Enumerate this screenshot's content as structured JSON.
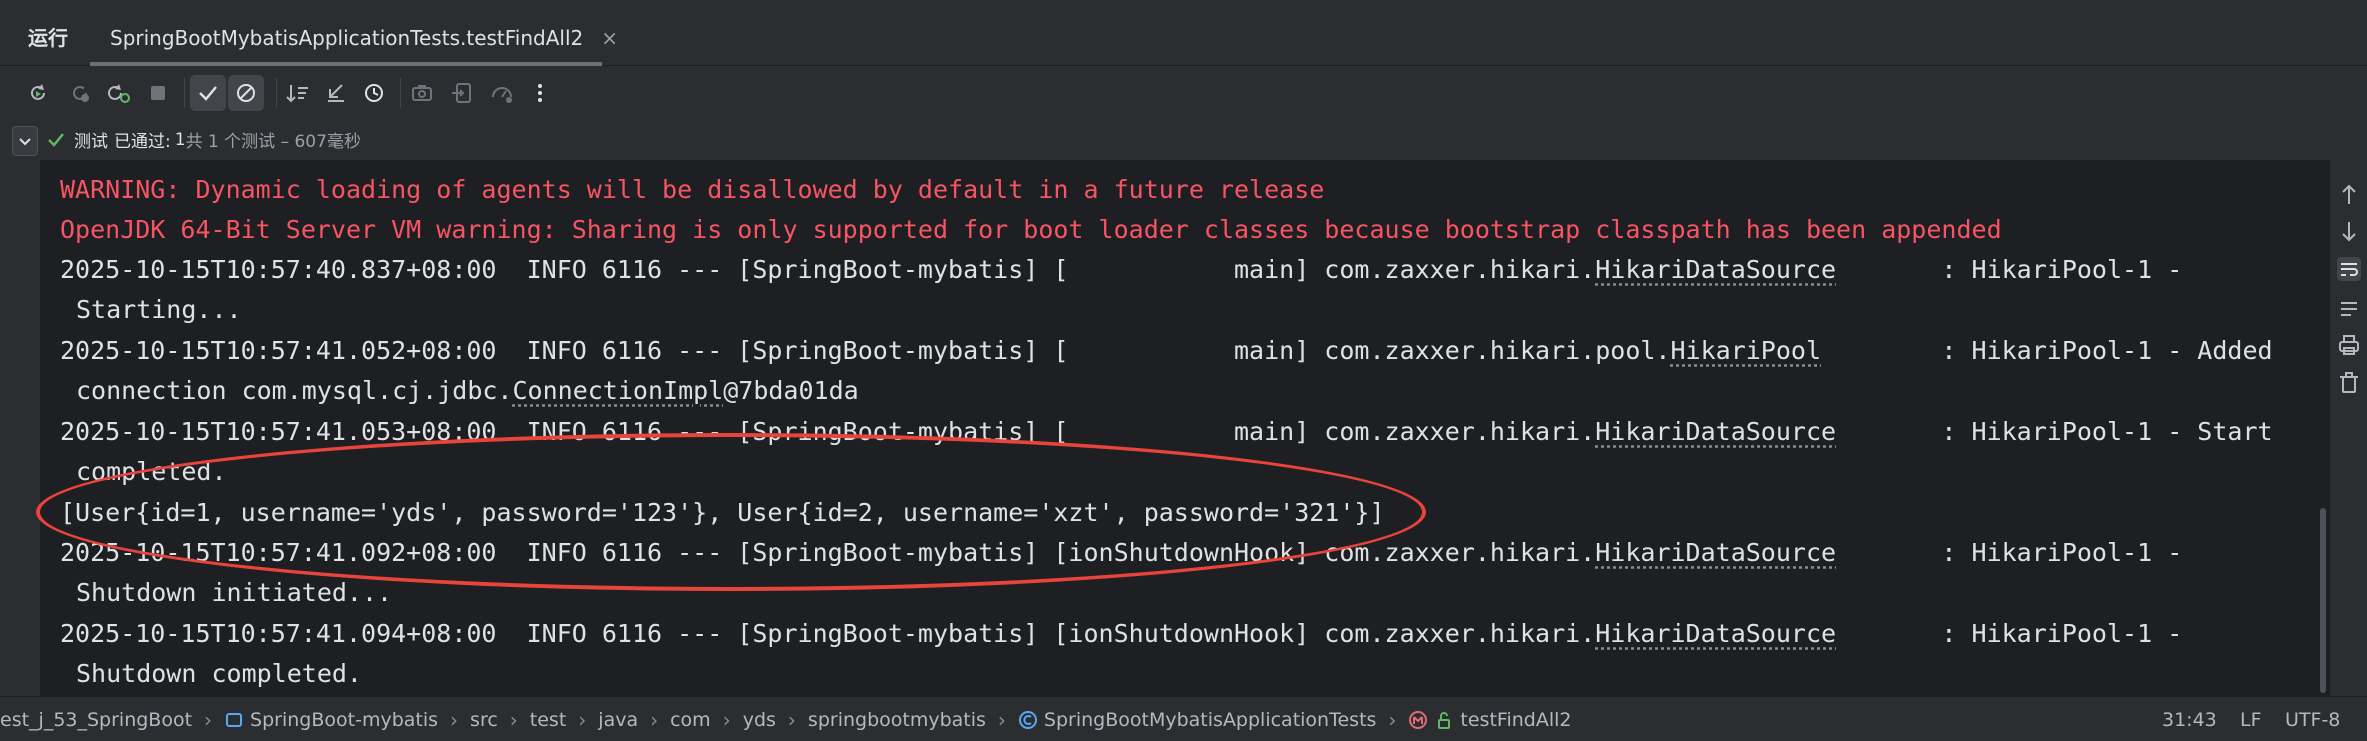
{
  "header": {
    "run_label": "运行",
    "tab_title": "SpringBootMybatisApplicationTests.testFindAll2",
    "tab_close": "×"
  },
  "status": {
    "test_label": "测试",
    "passed_label": "已通过:",
    "passed_count": "1",
    "detail": "共 1 个测试 – 607毫秒"
  },
  "console": {
    "lines": [
      "WARNING: Dynamic loading of agents will be disallowed by default in a future release",
      "OpenJDK 64-Bit Server VM warning: Sharing is only supported for boot loader classes because bootstrap classpath has been appended",
      "2025-10-15T10:57:40.837+08:00  INFO 6116 --- [SpringBoot-mybatis] [           main] com.zaxxer.hikari.",
      "Starting...",
      "2025-10-15T10:57:41.052+08:00  INFO 6116 --- [SpringBoot-mybatis] [           main] com.zaxxer.hikari.pool.",
      "connection com.mysql.cj.jdbc.",
      "2025-10-15T10:57:41.053+08:00  INFO 6116 --- [SpringBoot-mybatis] [           main] com.zaxxer.hikari.",
      "completed.",
      "[User{id=1, username='yds', password='123'}, User{id=2, username='xzt', password='321'}]",
      "2025-10-15T10:57:41.092+08:00  INFO 6116 --- [SpringBoot-mybatis] [ionShutdownHook] com.zaxxer.hikari.",
      "Shutdown initiated...",
      "2025-10-15T10:57:41.094+08:00  INFO 6116 --- [SpringBoot-mybatis] [ionShutdownHook] com.zaxxer.hikari.",
      "Shutdown completed."
    ],
    "links": {
      "ds1": "HikariDataSource",
      "pool": "HikariPool",
      "conn": "ConnectionImpl",
      "conn_suffix": "@7bda01da",
      "ds2": "HikariDataSource",
      "ds3": "HikariDataSource",
      "ds4": "HikariDataSource"
    },
    "tails": {
      "l1": "       : HikariPool-1 -",
      "l2": "        : HikariPool-1 - Added",
      "l3": "       : HikariPool-1 - Start",
      "l4": "       : HikariPool-1 -",
      "l5": "       : HikariPool-1 -"
    }
  },
  "breadcrumbs": {
    "items": [
      "est_j_53_SpringBoot",
      "SpringBoot-mybatis",
      "src",
      "test",
      "java",
      "com",
      "yds",
      "springbootmybatis",
      "SpringBootMybatisApplicationTests",
      "testFindAll2"
    ],
    "separator": "›"
  },
  "status_bar": {
    "position": "31:43",
    "line_ending": "LF",
    "encoding": "UTF-8"
  },
  "colors": {
    "background": "#1e1f22",
    "panel": "#2b2d30",
    "warning": "#f75464",
    "success": "#5fb865",
    "annotation": "#e8443b"
  }
}
